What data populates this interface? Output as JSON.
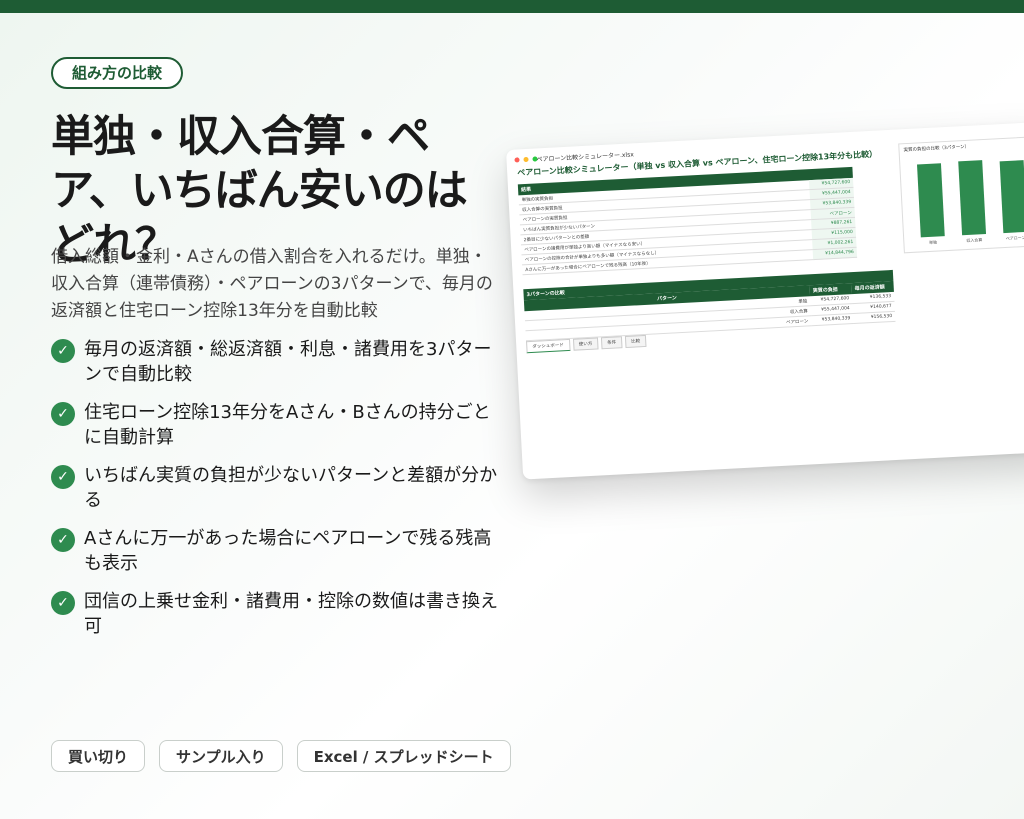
{
  "tag": "組み方の比較",
  "title": "単独・収入合算・ペア、いちばん安いのはどれ？",
  "lead": "借入総額・金利・Aさんの借入割合を入れるだけ。単独・収入合算（連帯債務）・ペアローンの3パターンで、毎月の返済額と住宅ローン控除13年分を自動比較",
  "features": [
    "毎月の返済額・総返済額・利息・諸費用を3パターンで自動比較",
    "住宅ローン控除13年分をAさん・Bさんの持分ごとに自動計算",
    "いちばん実質の負担が少ないパターンと差額が分かる",
    "Aさんに万一があった場合にペアローンで残る残高も表示",
    "団信の上乗せ金利・諸費用・控除の数値は書き換え可"
  ],
  "check_icon": "check-circle-icon",
  "chips": [
    "買い切り",
    "サンプル入り",
    "Excel / スプレッドシート"
  ],
  "colors": {
    "brand": "#1e5c34",
    "accent": "#2e8b4f"
  },
  "screenshot": {
    "window_title": "ペアローン比較シミュレーター.xlsx",
    "sheet_title": "ペアローン比較シミュレーター（単独 vs 収入合算 vs ペアローン、住宅ローン控除13年分も比較）",
    "summary_header": "結果",
    "summary_rows": [
      {
        "label": "単独の実質負担",
        "value": "¥54,727,600"
      },
      {
        "label": "収入合算の実質負担",
        "value": "¥55,447,004"
      },
      {
        "label": "ペアローンの実質負担",
        "value": "¥53,840,339"
      },
      {
        "label": "いちばん実質負担が少ないパターン",
        "value": "ペアローン"
      },
      {
        "label": "2番目に少ないパターンとの差額",
        "value": "¥887,261"
      },
      {
        "label": "ペアローンの諸費用が単独より高い額（マイナスなら安い）",
        "value": "¥115,000"
      },
      {
        "label": "ペアローンの控除の合計が単独よりも多い額（マイナスならなし）",
        "value": "¥1,002,261"
      },
      {
        "label": "Aさんに万一があった場合にペアローンで残る残高（10年後）",
        "value": "¥14,844,796"
      }
    ],
    "compare_header": "3パターンの比較",
    "compare_cols": [
      "パターン",
      "実質の負担",
      "毎月の返済額"
    ],
    "compare_rows": [
      {
        "name": "単独",
        "total": "¥54,727,600",
        "monthly": "¥136,533"
      },
      {
        "name": "収入合算",
        "total": "¥55,447,004",
        "monthly": "¥140,677"
      },
      {
        "name": "ペアローン",
        "total": "¥53,840,339",
        "monthly": "¥156,530"
      }
    ],
    "tabs": [
      "ダッシュボード",
      "使い方",
      "条件",
      "比較"
    ],
    "chart_data": {
      "type": "bar",
      "title": "実質の負担の比較（3パターン）",
      "categories": [
        "単独",
        "収入合算",
        "ペアローン"
      ],
      "values": [
        54727600,
        55447004,
        53840339
      ],
      "ylim": [
        0,
        60000000
      ],
      "color": "#2e8b4f"
    }
  }
}
